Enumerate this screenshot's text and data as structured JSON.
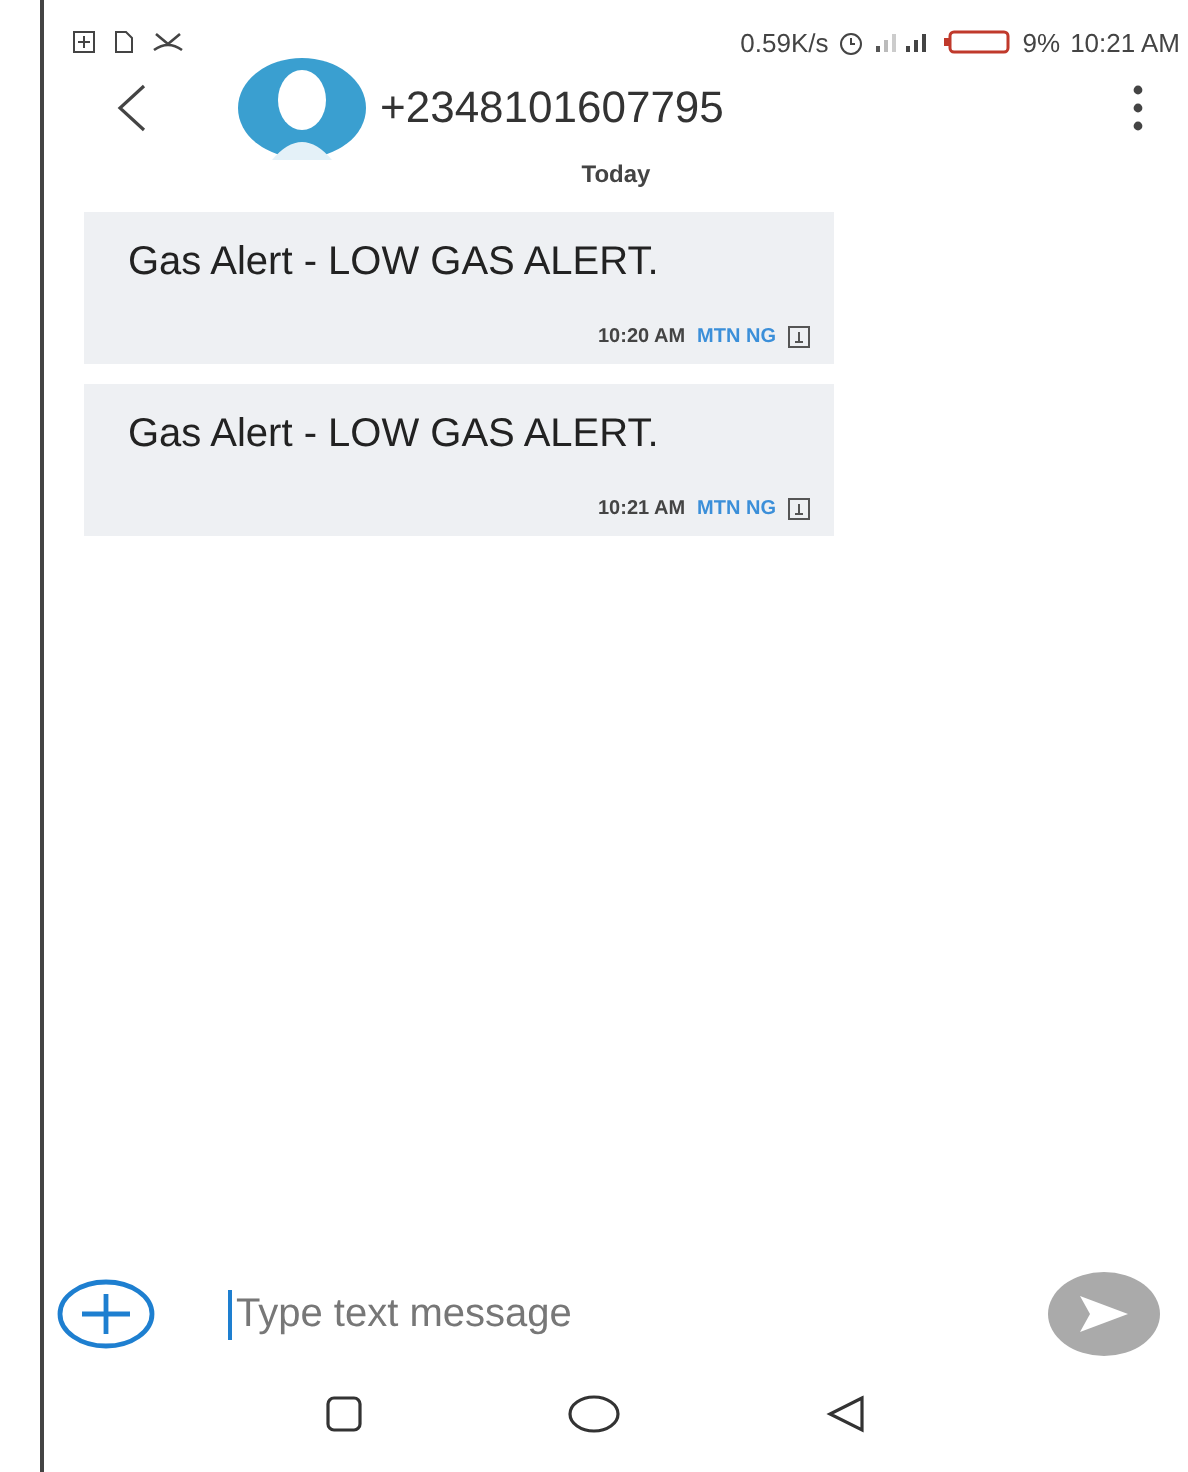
{
  "status_bar": {
    "net_speed": "0.59K/s",
    "battery": "9%",
    "time": "10:21 AM"
  },
  "header": {
    "title": "+2348101607795"
  },
  "date_divider": "Today",
  "messages": [
    {
      "text": "Gas Alert - LOW GAS ALERT.",
      "time": "10:20 AM",
      "sim": "MTN NG"
    },
    {
      "text": "Gas Alert - LOW GAS ALERT.",
      "time": "10:21 AM",
      "sim": "MTN NG"
    }
  ],
  "composer": {
    "placeholder": "Type text message"
  }
}
